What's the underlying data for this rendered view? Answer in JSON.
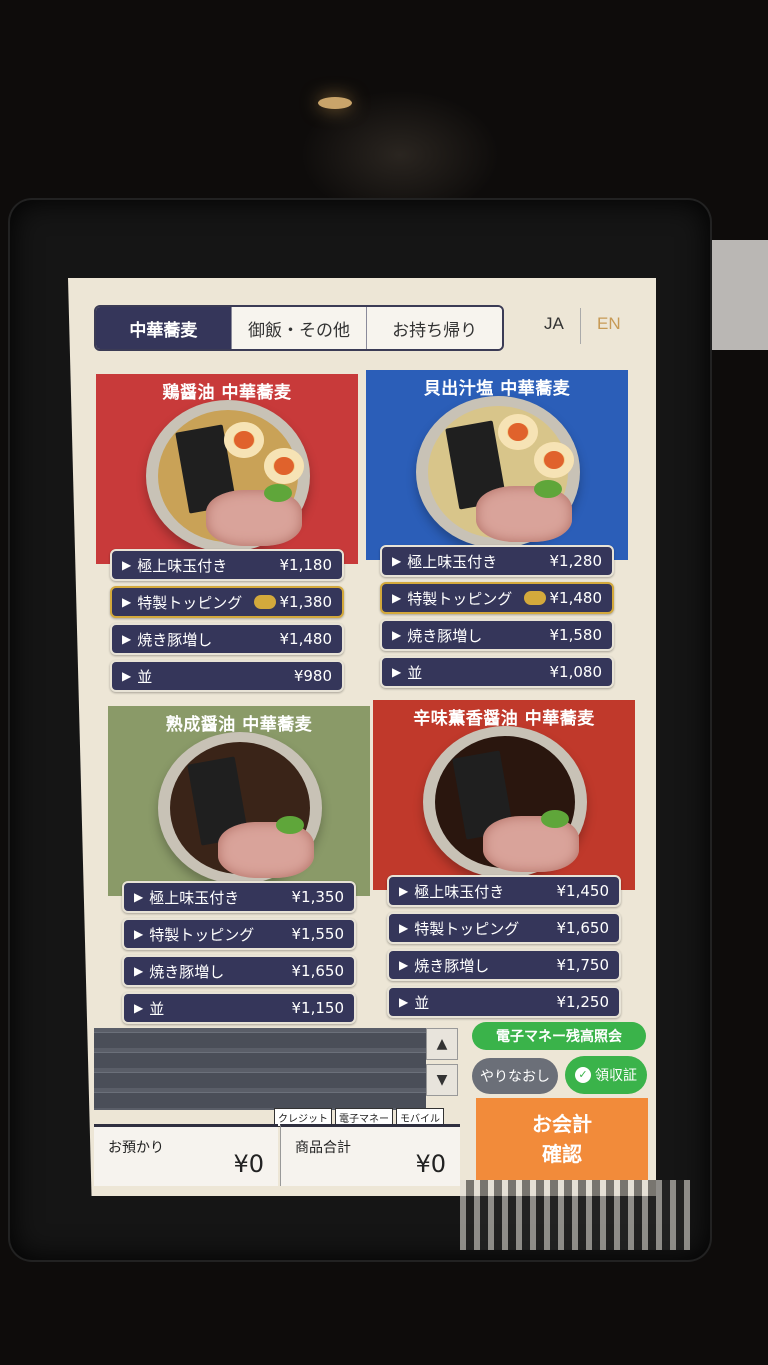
{
  "tabs": [
    {
      "label": "中華蕎麦",
      "active": true
    },
    {
      "label": "御飯・その他",
      "active": false
    },
    {
      "label": "お持ち帰り",
      "active": false
    }
  ],
  "language": {
    "ja": "JA",
    "en": "EN"
  },
  "menu": [
    {
      "title": "鶏醤油 中華蕎麦",
      "color": "#c83a3a",
      "items": [
        {
          "label": "極上味玉付き",
          "price": "¥1,180"
        },
        {
          "label": "特製トッピング",
          "price": "¥1,380",
          "special": true
        },
        {
          "label": "焼き豚増し",
          "price": "¥1,480"
        },
        {
          "label": "並",
          "price": "¥980"
        }
      ]
    },
    {
      "title": "貝出汁塩 中華蕎麦",
      "color": "#2b5eb8",
      "items": [
        {
          "label": "極上味玉付き",
          "price": "¥1,280"
        },
        {
          "label": "特製トッピング",
          "price": "¥1,480",
          "special": true
        },
        {
          "label": "焼き豚増し",
          "price": "¥1,580"
        },
        {
          "label": "並",
          "price": "¥1,080"
        }
      ]
    },
    {
      "title": "熟成醤油 中華蕎麦",
      "color": "#8a9a68",
      "items": [
        {
          "label": "極上味玉付き",
          "price": "¥1,350"
        },
        {
          "label": "特製トッピング",
          "price": "¥1,550"
        },
        {
          "label": "焼き豚増し",
          "price": "¥1,650"
        },
        {
          "label": "並",
          "price": "¥1,150"
        }
      ]
    },
    {
      "title": "辛味薫香醤油 中華蕎麦",
      "color": "#c0392b",
      "items": [
        {
          "label": "極上味玉付き",
          "price": "¥1,450"
        },
        {
          "label": "特製トッピング",
          "price": "¥1,650"
        },
        {
          "label": "焼き豚増し",
          "price": "¥1,750"
        },
        {
          "label": "並",
          "price": "¥1,250"
        }
      ]
    }
  ],
  "payment": {
    "methods": [
      "クレジット",
      "電子マネー",
      "モバイル"
    ],
    "deposit_label": "お預かり",
    "deposit_value": "¥0",
    "total_label": "商品合計",
    "total_value": "¥0"
  },
  "buttons": {
    "emoney": "電子マネー残高照会",
    "redo": "やりなおし",
    "receipt": "領収証",
    "checkout_line1": "お会計",
    "checkout_line2": "確認"
  }
}
